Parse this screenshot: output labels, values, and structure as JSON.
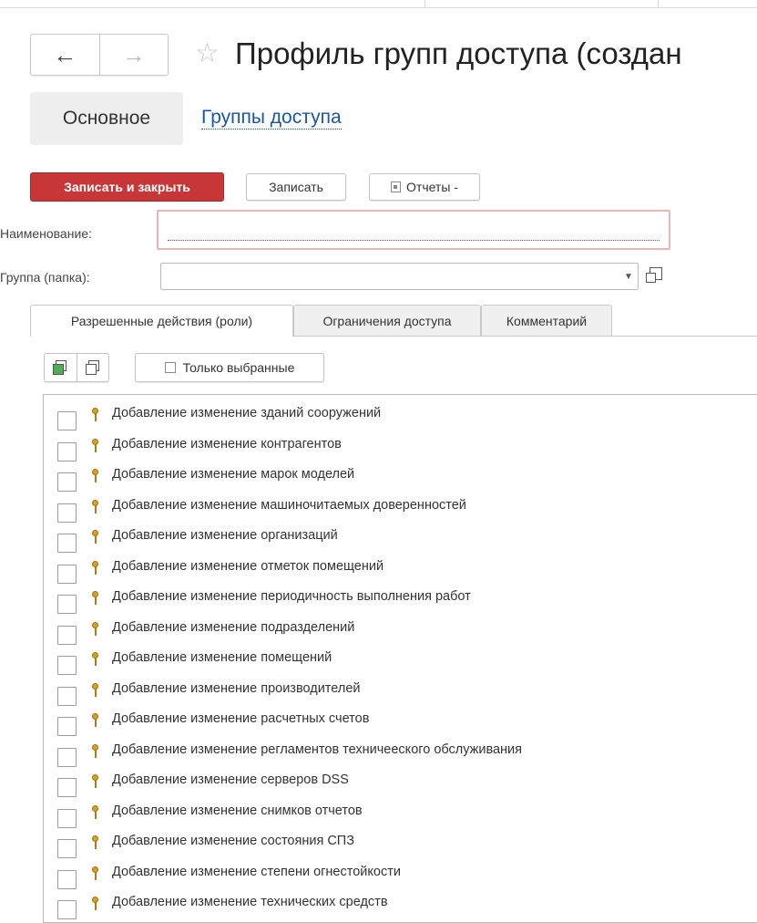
{
  "window": {
    "title": "Профиль групп доступа (создан"
  },
  "nav": {
    "back_icon": "arrow-left-icon",
    "forward_icon": "arrow-right-icon",
    "favorite_icon": "star-icon"
  },
  "form_tabs": [
    {
      "label": "Основное",
      "active": true
    },
    {
      "label": "Группы доступа",
      "active": false
    }
  ],
  "toolbar": {
    "save_close_label": "Записать и закрыть",
    "save_label": "Записать",
    "reports_label": "Отчеты -"
  },
  "fields": {
    "name_label": "Наименование:",
    "name_value": "",
    "group_label": "Группа (папка):",
    "group_value": ""
  },
  "tabs": [
    {
      "label": "Разрешенные действия (роли)",
      "active": true
    },
    {
      "label": "Ограничения доступа",
      "active": false
    },
    {
      "label": "Комментарий",
      "active": false
    }
  ],
  "list_toolbar": {
    "check_all_icon": "check-all-icon",
    "uncheck_all_icon": "uncheck-all-icon",
    "only_selected_label": "Только выбранные"
  },
  "roles": [
    {
      "label": "Добавление изменение зданий сооружений",
      "checked": false
    },
    {
      "label": "Добавление изменение контрагентов",
      "checked": false
    },
    {
      "label": "Добавление изменение марок моделей",
      "checked": false
    },
    {
      "label": "Добавление изменение машиночитаемых доверенностей",
      "checked": false
    },
    {
      "label": "Добавление изменение организаций",
      "checked": false
    },
    {
      "label": "Добавление изменение отметок помещений",
      "checked": false
    },
    {
      "label": "Добавление изменение периодичность выполнения работ",
      "checked": false
    },
    {
      "label": "Добавление изменение подразделений",
      "checked": false
    },
    {
      "label": "Добавление изменение помещений",
      "checked": false
    },
    {
      "label": "Добавление изменение производителей",
      "checked": false
    },
    {
      "label": "Добавление изменение расчетных счетов",
      "checked": false
    },
    {
      "label": "Добавление изменение регламентов техничееского обслуживания",
      "checked": false
    },
    {
      "label": "Добавление изменение серверов DSS",
      "checked": false
    },
    {
      "label": "Добавление изменение снимков отчетов",
      "checked": false
    },
    {
      "label": "Добавление изменение состояния СПЗ",
      "checked": false
    },
    {
      "label": "Добавление изменение степени огнестойкости",
      "checked": false
    },
    {
      "label": "Добавление изменение технических средств",
      "checked": false
    }
  ],
  "colors": {
    "primary_button": "#c83737",
    "link": "#1a56a8",
    "key_icon": "#d9a21b"
  }
}
